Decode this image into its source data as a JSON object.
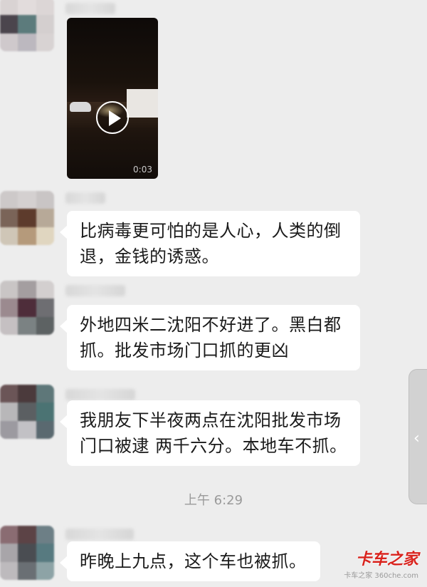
{
  "chat": {
    "video_message": {
      "duration": "0:03",
      "play_icon": "play-icon"
    },
    "messages": [
      {
        "text_line1": "比病毒更可怕的是人心，人类的倒",
        "text_line2": "退，金钱的诱惑。"
      },
      {
        "text_line1": "外地四米二沈阳不好进了。黑白都",
        "text_line2": "抓。批发市场门口抓的更凶"
      },
      {
        "text_line1": "我朋友下半夜两点在沈阳批发市场",
        "text_line2": "门口被逮 两千六分。本地车不抓。"
      },
      {
        "text_line1": "昨晚上九点，这个车也被抓。",
        "text_line2": ""
      }
    ],
    "timestamp": "上午 6:29"
  },
  "side_panel": {
    "icon": "chevron-left-icon",
    "glyph": "‹"
  },
  "watermark": {
    "main": "卡车之家",
    "sub": "卡车之家 360che.com"
  },
  "colors": {
    "background": "#ededed",
    "bubble": "#ffffff",
    "watermark": "#d9231d"
  }
}
